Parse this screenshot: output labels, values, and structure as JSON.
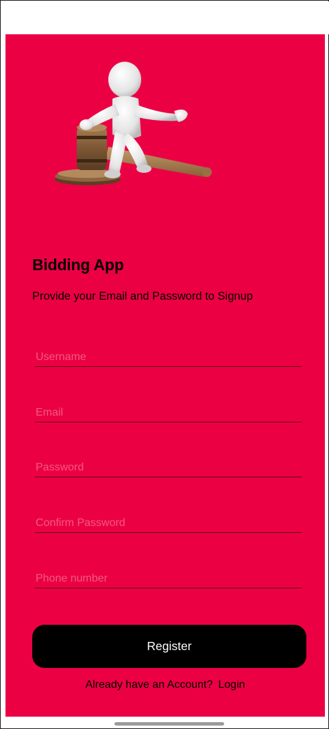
{
  "app": {
    "title": "Bidding App",
    "subtitle": "Provide your Email and Password to Signup"
  },
  "hero": {
    "icon": "auction-gavel-figure-icon"
  },
  "form": {
    "fields": [
      {
        "name": "username",
        "placeholder": "Username",
        "value": ""
      },
      {
        "name": "email",
        "placeholder": "Email",
        "value": ""
      },
      {
        "name": "password",
        "placeholder": "Password",
        "value": ""
      },
      {
        "name": "confirm_password",
        "placeholder": "Confirm Password",
        "value": ""
      },
      {
        "name": "phone",
        "placeholder": "Phone number",
        "value": ""
      }
    ],
    "register_label": "Register"
  },
  "footer": {
    "prompt": "Already have an Account?",
    "login_label": "Login"
  },
  "colors": {
    "background": "#ec0044",
    "button": "#000000",
    "button_text": "#ffffff",
    "placeholder": "#f05a80"
  }
}
